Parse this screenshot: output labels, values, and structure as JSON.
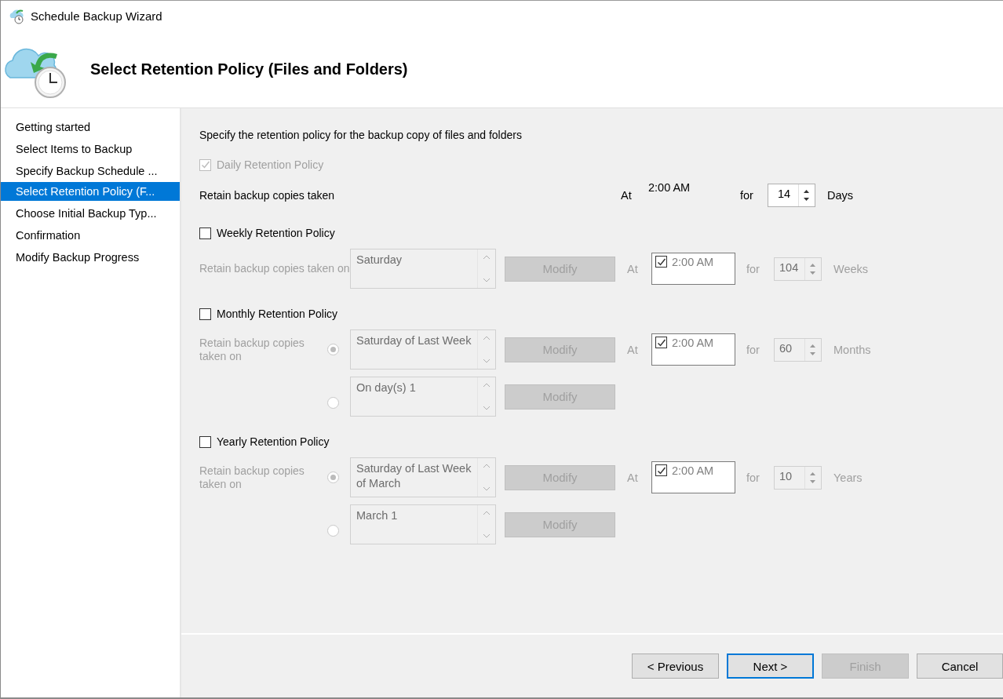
{
  "window": {
    "title": "Schedule Backup Wizard"
  },
  "header": {
    "title": "Select Retention Policy (Files and Folders)"
  },
  "sidebar": {
    "items": [
      {
        "label": "Getting started",
        "selected": false
      },
      {
        "label": "Select Items to Backup",
        "selected": false
      },
      {
        "label": "Specify Backup Schedule ...",
        "selected": false
      },
      {
        "label": "Select Retention Policy (F...",
        "selected": true
      },
      {
        "label": "Choose Initial Backup Typ...",
        "selected": false
      },
      {
        "label": "Confirmation",
        "selected": false
      },
      {
        "label": "Modify Backup Progress",
        "selected": false
      }
    ]
  },
  "content": {
    "intro": "Specify the retention policy for the backup copy of files and folders",
    "daily": {
      "label": "Daily Retention Policy",
      "checked": true,
      "disabled": true,
      "retain_label": "Retain backup copies taken",
      "at_label": "At",
      "time": "2:00 AM",
      "for_label": "for",
      "value": "14",
      "unit": "Days"
    },
    "policies": [
      {
        "label": "Weekly Retention Policy",
        "checked": false,
        "retain_label": "Retain backup copies taken on",
        "at_label": "At",
        "time_checked": true,
        "time": "2:00 AM",
        "for_label": "for",
        "value": "104",
        "unit": "Weeks",
        "options": [
          {
            "kind": "plain",
            "schedule": "Saturday",
            "button": "Modify"
          }
        ]
      },
      {
        "label": "Monthly Retention Policy",
        "checked": false,
        "retain_label": "Retain backup copies taken on",
        "at_label": "At",
        "time_checked": true,
        "time": "2:00 AM",
        "for_label": "for",
        "value": "60",
        "unit": "Months",
        "options": [
          {
            "kind": "radio",
            "selected": true,
            "schedule": "Saturday of Last Week",
            "button": "Modify"
          },
          {
            "kind": "radio",
            "selected": false,
            "schedule": "On day(s) 1",
            "button": "Modify"
          }
        ]
      },
      {
        "label": "Yearly Retention Policy",
        "checked": false,
        "retain_label": "Retain backup copies taken on",
        "at_label": "At",
        "time_checked": true,
        "time": "2:00 AM",
        "for_label": "for",
        "value": "10",
        "unit": "Years",
        "options": [
          {
            "kind": "radio",
            "selected": true,
            "schedule": "Saturday of Last Week of March",
            "button": "Modify"
          },
          {
            "kind": "radio",
            "selected": false,
            "schedule": "March 1",
            "button": "Modify"
          }
        ]
      }
    ]
  },
  "footer": {
    "buttons": [
      {
        "label": "< Previous",
        "kind": "normal",
        "disabled": false
      },
      {
        "label": "Next >",
        "kind": "default",
        "disabled": false
      },
      {
        "label": "Finish",
        "kind": "normal",
        "disabled": true
      },
      {
        "label": "Cancel",
        "kind": "normal",
        "disabled": false
      }
    ]
  }
}
